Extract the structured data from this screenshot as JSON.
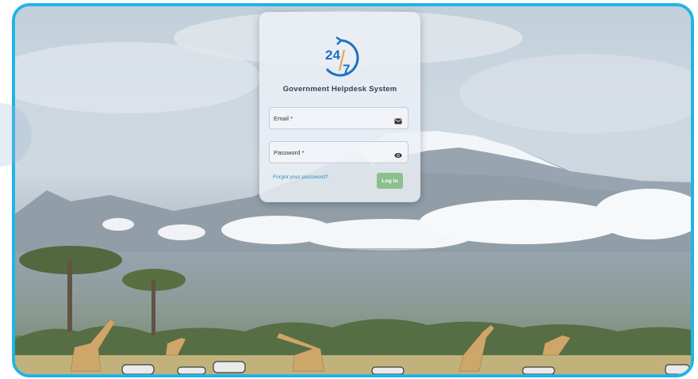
{
  "logo": {
    "text_top": "24",
    "text_bottom": "7",
    "icon": "clock-24-7-logo",
    "color": "#1e6fc4",
    "accent": "#e8a23a"
  },
  "app_title": "Government Helpdesk System",
  "email": {
    "label": "Email *",
    "icon": "email-icon"
  },
  "password": {
    "label": "Password *",
    "icon": "eye-icon"
  },
  "forgot_link": "Forgot your password?",
  "login_button": "Log in",
  "colors": {
    "frame_border": "#21b4e6",
    "button": "#8cbf8e",
    "link": "#2e8bc8"
  }
}
